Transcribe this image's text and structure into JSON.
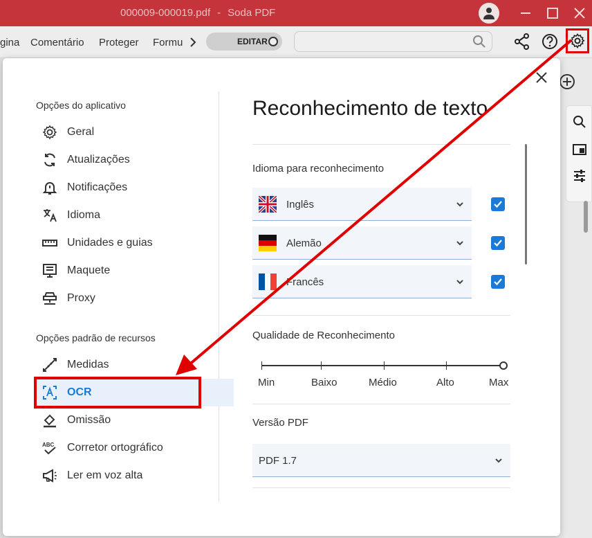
{
  "titlebar": {
    "filename": "000009-000019.pdf",
    "separator": "-",
    "app_name": "Soda PDF"
  },
  "menubar": {
    "items": [
      "gina",
      "Comentário",
      "Proteger",
      "Formu"
    ],
    "edit_toggle": "EDITAR",
    "search": {
      "value": "",
      "placeholder": ""
    }
  },
  "sidebar": {
    "app_section": "Opções do aplicativo",
    "app_items": [
      {
        "label": "Geral",
        "icon": "gear-icon"
      },
      {
        "label": "Atualizações",
        "icon": "sync-icon"
      },
      {
        "label": "Notificações",
        "icon": "bell-icon"
      },
      {
        "label": "Idioma",
        "icon": "translate-icon"
      },
      {
        "label": "Unidades e guias",
        "icon": "ruler-icon"
      },
      {
        "label": "Maquete",
        "icon": "layout-icon"
      },
      {
        "label": "Proxy",
        "icon": "proxy-icon"
      }
    ],
    "resource_section": "Opções padrão de recursos",
    "resource_items": [
      {
        "label": "Medidas",
        "icon": "measure-icon"
      },
      {
        "label": "OCR",
        "icon": "ocr-icon",
        "active": true
      },
      {
        "label": "Omissão",
        "icon": "eraser-icon"
      },
      {
        "label": "Corretor ortográfico",
        "icon": "spellcheck-icon"
      },
      {
        "label": "Ler em voz alta",
        "icon": "megaphone-icon"
      }
    ]
  },
  "content": {
    "title": "Reconhecimento de texto",
    "language_heading": "Idioma para reconhecimento",
    "languages": [
      {
        "name": "Inglês",
        "flag": "uk-flag-icon",
        "checked": true
      },
      {
        "name": "Alemão",
        "flag": "germany-flag-icon",
        "checked": true
      },
      {
        "name": "Francês",
        "flag": "france-flag-icon",
        "checked": true
      }
    ],
    "quality_heading": "Qualidade de Reconhecimento",
    "quality_levels": [
      "Min",
      "Baixo",
      "Médio",
      "Alto",
      "Max"
    ],
    "quality_selected": "Max",
    "pdf_heading": "Versão PDF",
    "pdf_version": "PDF 1.7"
  },
  "colors": {
    "titlebar": "#c4343a",
    "accent": "#1a7ad6",
    "annotation": "#e10000"
  }
}
